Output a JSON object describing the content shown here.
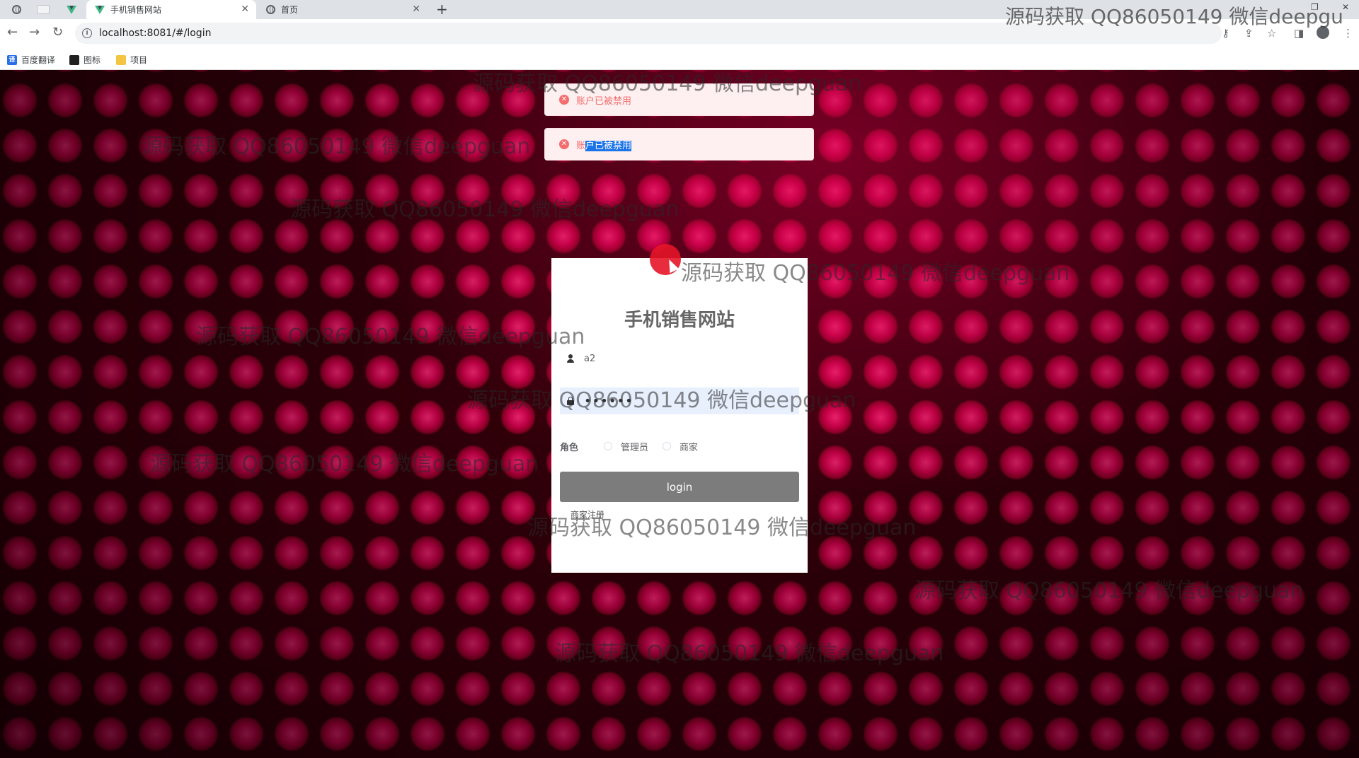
{
  "browser": {
    "tabs": [
      {
        "title": "",
        "icon": "globe-icon",
        "kind": "pinned"
      },
      {
        "title": "",
        "icon": "blank-page-icon",
        "kind": "pinned"
      },
      {
        "title": "",
        "icon": "vue-logo-icon",
        "kind": "pinned"
      },
      {
        "title": "手机销售网站",
        "icon": "vue-logo-icon",
        "active": true
      },
      {
        "title": "首页",
        "icon": "globe-icon",
        "active": false
      }
    ],
    "url": "localhost:8081/#/login",
    "bookmarks": [
      {
        "label": "百度翻译",
        "icon": "translate-icon",
        "color": "#2a6ee8"
      },
      {
        "label": "图标",
        "icon": "image-icon",
        "color": "#1f1f1f"
      },
      {
        "label": "项目",
        "icon": "folder-icon",
        "color": "#f4c542"
      }
    ]
  },
  "messages": [
    {
      "prefix": "账户已被禁用",
      "selected": ""
    },
    {
      "prefix": "账",
      "selected": "户已被禁用"
    }
  ],
  "login": {
    "title": "手机销售网站",
    "username_value": "a2",
    "password_value": "••••••",
    "role_label": "角色",
    "roles": [
      "管理员",
      "商家"
    ],
    "button_label": "login",
    "register_link": "商家注册"
  },
  "watermark": "源码获取 QQ86050149 微信deepguan",
  "watermark_top": "源码获取 QQ86050149 微信deepgu",
  "colors": {
    "accent_error": "#f56c6c",
    "button": "#7c7c7c",
    "background": "#35000a"
  }
}
